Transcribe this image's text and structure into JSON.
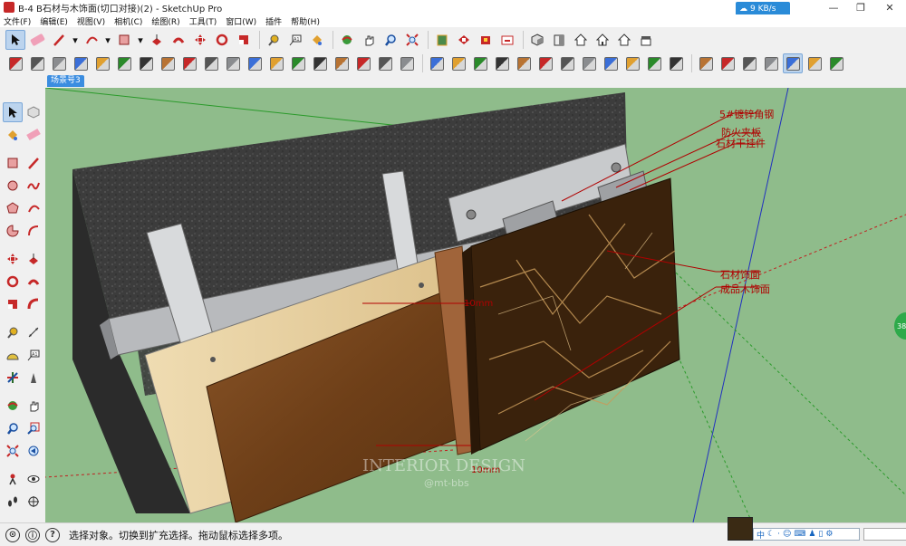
{
  "window": {
    "title": "B-4 B石材与木饰面(切口对接)(2) - SketchUp Pro",
    "net_speed": "9 KB/s",
    "minimize_glyph": "—",
    "restore_glyph": "❐",
    "close_glyph": "✕"
  },
  "menu": {
    "items": [
      "文件(F)",
      "编辑(E)",
      "视图(V)",
      "相机(C)",
      "绘图(R)",
      "工具(T)",
      "窗口(W)",
      "插件",
      "帮助(H)"
    ]
  },
  "toolbar_row1": {
    "icons": [
      "select-icon",
      "eraser-icon",
      "pencil-line-icon",
      "dropdown-icon",
      "arc-icon",
      "dropdown-icon",
      "rectangle-icon",
      "dropdown-icon",
      "push-pull-icon",
      "follow-me-icon",
      "move-icon",
      "rotate-icon",
      "scale-icon",
      "tape-measure-icon",
      "text-icon",
      "paint-bucket-icon",
      "orbit-icon",
      "pan-icon",
      "zoom-icon",
      "zoom-extents-icon",
      "section-plane-icon",
      "warehouse-icon",
      "extension-warehouse-icon",
      "layout-icon",
      "iso-view-icon",
      "top-view-icon",
      "front-view-icon",
      "right-view-icon",
      "back-view-icon",
      "left-view-icon"
    ]
  },
  "toolbar_row2": {
    "active_index": 35
  },
  "scene_tab": "场景号3",
  "viewport": {
    "annotations": [
      {
        "label": "5#镀锌角钢"
      },
      {
        "label": "防火夹板"
      },
      {
        "label": "石材干挂件"
      },
      {
        "label": "石材饰面"
      },
      {
        "label": "成品木饰面"
      }
    ],
    "dimension_top": "10mm",
    "dimension_bottom": "10mm",
    "watermark_main": "INTERIOR DESIGN",
    "watermark_sub": "@mt-bbs",
    "side_badge": "38"
  },
  "status": {
    "text": "选择对象。切换到扩充选择。拖动鼠标选择多项。",
    "icons": [
      "geo-location-icon",
      "credits-icon",
      "help-icon"
    ]
  },
  "ime": {
    "label": "中"
  },
  "colors": {
    "sky": "#d8e4ee",
    "ground": "#8fbc8b",
    "concrete": "#3a3a3a",
    "steel": "#b8babd",
    "plywood": "#e6d2a8",
    "wood": "#7a4a22",
    "marble": "#3a220c",
    "annotation": "#b00000",
    "accent": "#2a8bd8"
  }
}
